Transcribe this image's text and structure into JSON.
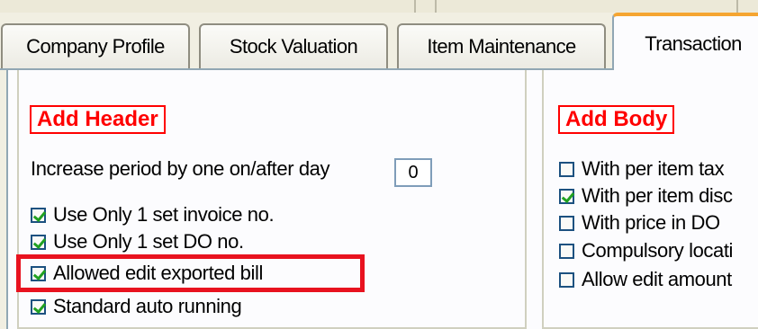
{
  "tabs": [
    {
      "label": "Company Profile",
      "active": false
    },
    {
      "label": "Stock Valuation",
      "active": false
    },
    {
      "label": "Item Maintenance",
      "active": false
    },
    {
      "label": "Transaction",
      "active": true
    }
  ],
  "header_section": {
    "title": "Add Header",
    "increase_period": {
      "label": "Increase period by one on/after day",
      "value": "0"
    },
    "options": [
      {
        "label": "Use Only 1 set invoice no.",
        "checked": true
      },
      {
        "label": "Use Only 1 set DO no.",
        "checked": true
      },
      {
        "label": "Allowed edit exported bill",
        "checked": true
      },
      {
        "label": "Standard auto running",
        "checked": true
      }
    ]
  },
  "body_section": {
    "title": "Add Body",
    "options": [
      {
        "label": "With per item tax",
        "checked": false
      },
      {
        "label": "With per item disc",
        "checked": true
      },
      {
        "label": "With price in DO",
        "checked": false
      },
      {
        "label": "Compulsory locati",
        "checked": false
      },
      {
        "label": "Allow edit amount",
        "checked": false
      }
    ]
  },
  "colors": {
    "section_title": "#ff0000",
    "highlight": "#e8121f",
    "active_tab_top": "#f5a531",
    "check": "#21a121"
  }
}
